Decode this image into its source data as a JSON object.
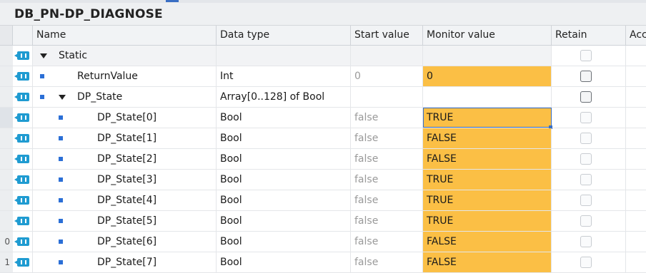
{
  "title": "DB_PN-DP_DIAGNOSE",
  "columns": {
    "name": "Name",
    "data_type": "Data type",
    "start_value": "Start value",
    "monitor_value": "Monitor value",
    "retain": "Retain",
    "accessible": "Acc"
  },
  "rows": [
    {
      "gutter": "",
      "name": "Static",
      "type": "",
      "start": "",
      "monitor": "",
      "retain_enabled": false
    },
    {
      "gutter": "",
      "name": "ReturnValue",
      "type": "Int",
      "start": "0",
      "monitor": "0",
      "retain_enabled": true
    },
    {
      "gutter": "",
      "name": "DP_State",
      "type": "Array[0..128] of Bool",
      "start": "",
      "monitor": "",
      "retain_enabled": true
    },
    {
      "gutter": "",
      "name": "DP_State[0]",
      "type": "Bool",
      "start": "false",
      "monitor": "TRUE",
      "retain_enabled": false
    },
    {
      "gutter": "",
      "name": "DP_State[1]",
      "type": "Bool",
      "start": "false",
      "monitor": "FALSE",
      "retain_enabled": false
    },
    {
      "gutter": "",
      "name": "DP_State[2]",
      "type": "Bool",
      "start": "false",
      "monitor": "FALSE",
      "retain_enabled": false
    },
    {
      "gutter": "",
      "name": "DP_State[3]",
      "type": "Bool",
      "start": "false",
      "monitor": "TRUE",
      "retain_enabled": false
    },
    {
      "gutter": "",
      "name": "DP_State[4]",
      "type": "Bool",
      "start": "false",
      "monitor": "TRUE",
      "retain_enabled": false
    },
    {
      "gutter": "",
      "name": "DP_State[5]",
      "type": "Bool",
      "start": "false",
      "monitor": "TRUE",
      "retain_enabled": false
    },
    {
      "gutter": "0",
      "name": "DP_State[6]",
      "type": "Bool",
      "start": "false",
      "monitor": "FALSE",
      "retain_enabled": false
    },
    {
      "gutter": "1",
      "name": "DP_State[7]",
      "type": "Bool",
      "start": "false",
      "monitor": "FALSE",
      "retain_enabled": false
    }
  ],
  "colors": {
    "monitor_highlight": "#fbbf45",
    "db_icon": "#1f9bd1",
    "member_bullet": "#2b6fd6",
    "selection": "#3a6fc4"
  },
  "icons": {
    "row_icon": "db-interface-icon",
    "expand": "expand-triangle-icon",
    "member": "member-bullet-icon"
  }
}
